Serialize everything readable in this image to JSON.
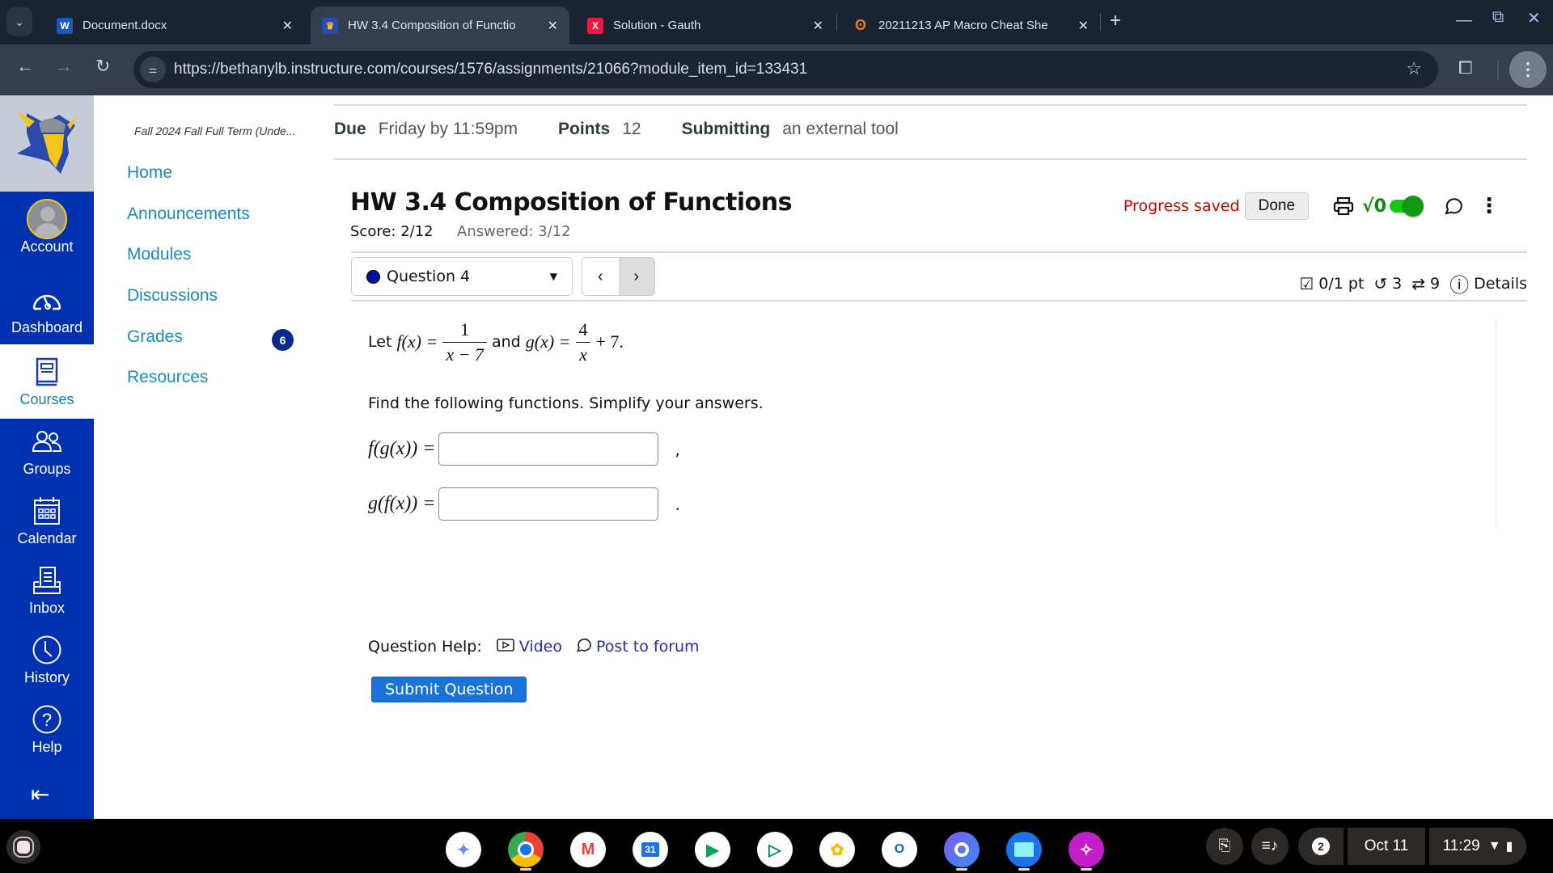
{
  "browser": {
    "tabs": [
      {
        "title": "Document.docx",
        "favicon": "word-icon",
        "active": false
      },
      {
        "title": "HW 3.4 Composition of Functio",
        "favicon": "viking-icon",
        "active": true
      },
      {
        "title": "Solution - Gauth",
        "favicon": "gauth-icon",
        "active": false
      },
      {
        "title": "20211213 AP Macro Cheat She",
        "favicon": "hubspot-icon",
        "active": false
      }
    ],
    "url": "https://bethanylb.instructure.com/courses/1576/assignments/21066?module_item_id=133431"
  },
  "global_nav": {
    "items": [
      {
        "label": "Account",
        "icon": "avatar"
      },
      {
        "label": "Dashboard",
        "icon": "dashboard-icon"
      },
      {
        "label": "Courses",
        "icon": "courses-icon",
        "active": true
      },
      {
        "label": "Groups",
        "icon": "groups-icon"
      },
      {
        "label": "Calendar",
        "icon": "calendar-icon"
      },
      {
        "label": "Inbox",
        "icon": "inbox-icon"
      },
      {
        "label": "History",
        "icon": "history-icon"
      },
      {
        "label": "Help",
        "icon": "help-icon"
      }
    ]
  },
  "course_nav": {
    "term": "Fall 2024 Fall Full Term (Unde...",
    "links": [
      "Home",
      "Announcements",
      "Modules",
      "Discussions",
      "Grades",
      "Resources"
    ],
    "grades_badge": "6"
  },
  "assignment": {
    "due_label": "Due",
    "due_value": "Friday by 11:59pm",
    "points_label": "Points",
    "points_value": "12",
    "submitting_label": "Submitting",
    "submitting_value": "an external tool"
  },
  "homework": {
    "title": "HW 3.4 Composition of Functions",
    "score": "Score: 2/12",
    "answered": "Answered: 3/12",
    "progress_status": "Progress saved",
    "done_label": "Done",
    "sqrt_label": "√0",
    "question_select": "Question 4",
    "question_points": "0/1 pt",
    "retries": "3",
    "attempts": "9",
    "details_label": "Details"
  },
  "question": {
    "let": "Let",
    "f_def_lhs": "f(x) =",
    "f_num": "1",
    "f_den": "x − 7",
    "and": "and",
    "g_def_lhs": "g(x) =",
    "g_num": "4",
    "g_den": "x",
    "g_tail": "+ 7.",
    "instruction": "Find the following functions. Simplify your answers.",
    "answers": [
      {
        "label": "f(g(x)) =",
        "value": "",
        "punct": ","
      },
      {
        "label": "g(f(x)) =",
        "value": "",
        "punct": "."
      }
    ],
    "help_label": "Question Help:",
    "video_label": "Video",
    "forum_label": "Post to forum",
    "submit_label": "Submit Question"
  },
  "shelf": {
    "apps": [
      "gemini",
      "chrome",
      "gmail",
      "calendar",
      "meet",
      "play-store",
      "photos",
      "outlook",
      "copilot",
      "files",
      "canvas-app"
    ],
    "calendar_day": "31",
    "notifications": "2",
    "date": "Oct 11",
    "time": "11:29"
  }
}
